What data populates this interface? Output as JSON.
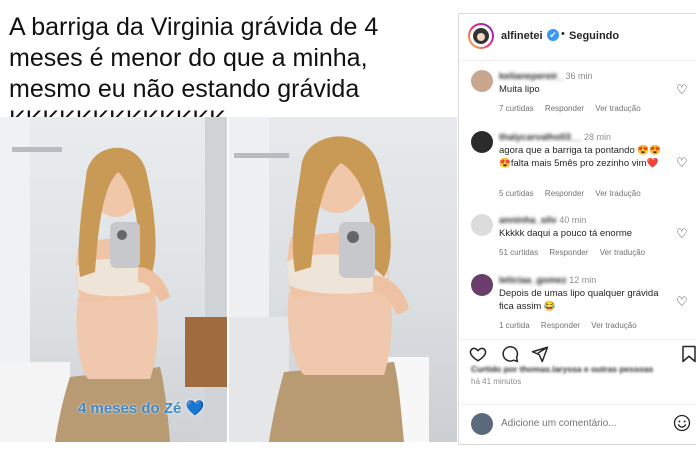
{
  "headline": "A barriga da Virginia grávida de 4 meses é menor do que a minha, mesmo eu não estando grávida KKKKKKKKKKKKK",
  "story_caption": "4 meses do Zé",
  "story_caption_emoji": "💙",
  "post": {
    "username": "alfinetei",
    "verified_mark": "✔",
    "separator": "•",
    "follow_status": "Seguindo"
  },
  "comments": [
    {
      "user": "kelianepereir_",
      "time": "36 min",
      "text": "Muita lipo",
      "likes": "7 curtidas",
      "reply": "Responder",
      "translate": "Ver tradução",
      "avatar_color": "#c9a78f"
    },
    {
      "user": "thalycarvalho03__",
      "time": "28 min",
      "text": "agora que a barriga ta pontando 😍😍😍falta mais 5mês pro zezinho vim❤️",
      "likes": "5 curtidas",
      "reply": "Responder",
      "translate": "Ver tradução",
      "avatar_color": "#2b2b2b"
    },
    {
      "user": "anninha_silv",
      "time": "40 min",
      "text": "Kkkkk daqui a pouco tá enorme",
      "likes": "51 curtidas",
      "reply": "Responder",
      "translate": "Ver tradução",
      "avatar_color": "#dcdcdc"
    },
    {
      "user": "leticiaa_gomez",
      "time": "12 min",
      "text": "Depois de umas lipo qualquer grávida fica assim 😂",
      "likes": "1 curtida",
      "reply": "Responder",
      "translate": "Ver tradução",
      "avatar_color": "#6a3d6d"
    }
  ],
  "liked_by": "Curtido por thomas.laryssa e outras pessoas",
  "time_ago": "há 41 minutos",
  "comment_placeholder": "Adicione um comentário...",
  "icons": {
    "like": "heart-icon",
    "comment": "comment-icon",
    "share": "share-icon",
    "save": "bookmark-icon",
    "emoji": "emoji-icon",
    "verified": "verified-badge-icon"
  },
  "colors": {
    "caption_blue": "#3f88c5",
    "verified_blue": "#3897f0",
    "muted_text": "#737373"
  }
}
